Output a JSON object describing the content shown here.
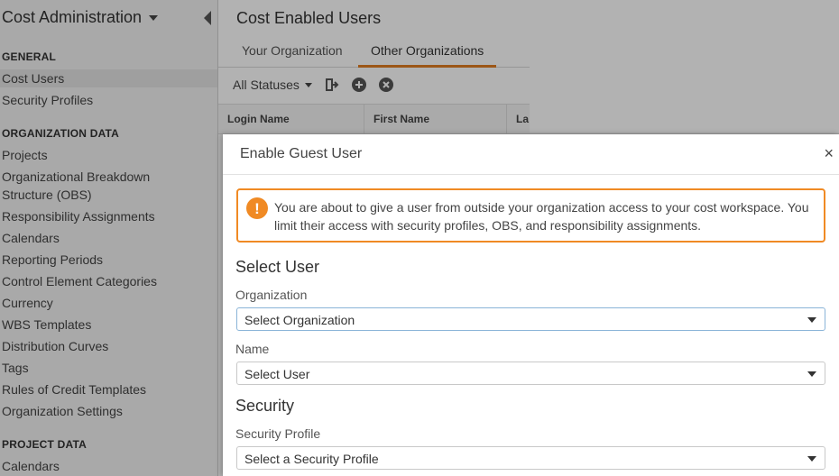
{
  "sidebar": {
    "title": "Cost Administration",
    "sections": [
      {
        "label": "GENERAL",
        "items": [
          "Cost Users",
          "Security Profiles"
        ]
      },
      {
        "label": "ORGANIZATION DATA",
        "items": [
          "Projects",
          "Organizational Breakdown",
          "Structure (OBS)",
          "Responsibility Assignments",
          "Calendars",
          "Reporting Periods",
          "Control Element Categories",
          "Currency",
          "WBS Templates",
          "Distribution Curves",
          "Tags",
          "Rules of Credit Templates",
          "Organization Settings"
        ]
      },
      {
        "label": "PROJECT DATA",
        "items": [
          "Calendars"
        ]
      }
    ],
    "active_item": "Cost Users"
  },
  "main": {
    "title": "Cost Enabled Users",
    "tabs": [
      {
        "label": "Your Organization",
        "active": false
      },
      {
        "label": "Other Organizations",
        "active": true
      }
    ],
    "toolbar": {
      "status_filter": "All Statuses",
      "icons": [
        "export-icon",
        "add-icon",
        "remove-icon"
      ]
    },
    "grid_columns": [
      "Login Name",
      "First Name",
      "La"
    ]
  },
  "modal": {
    "title": "Enable Guest User",
    "close_glyph": "×",
    "alert_text": "You are about to give a user from outside your organization access to your cost workspace. You limit their access with security profiles, OBS, and responsibility assignments.",
    "alert_glyph": "!",
    "sections": {
      "select_user": "Select User",
      "security": "Security"
    },
    "fields": {
      "organization": {
        "label": "Organization",
        "value": "Select Organization"
      },
      "name": {
        "label": "Name",
        "value": "Select User"
      },
      "security_profile": {
        "label": "Security Profile",
        "value": "Select a Security Profile"
      }
    }
  },
  "colors": {
    "accent": "#e07b22",
    "alert_border": "#f08a24",
    "focus_border": "#8ab4d8"
  }
}
